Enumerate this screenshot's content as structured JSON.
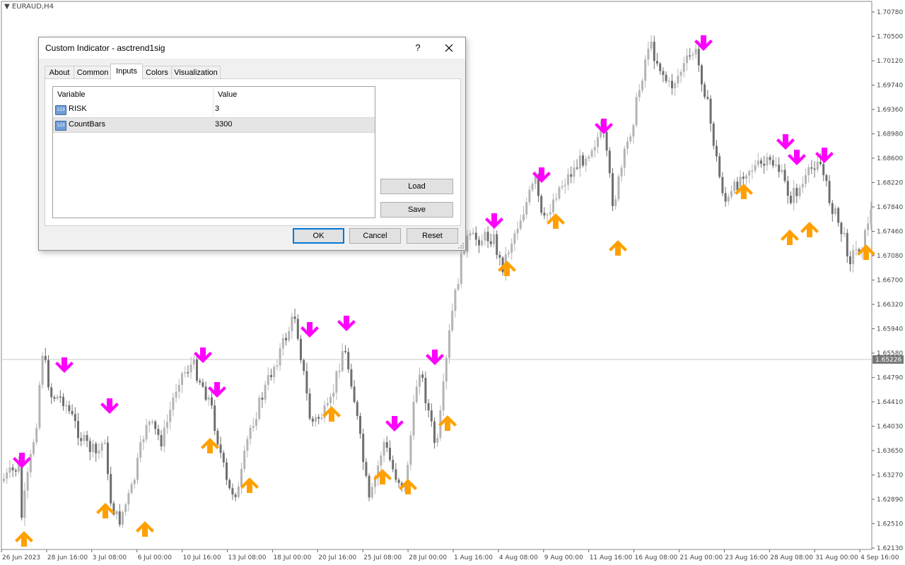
{
  "symbol": "EURAUD,H4",
  "current_price": "1.65226",
  "price_ticks": [
    "1.70780",
    "1.70500",
    "1.70120",
    "1.69740",
    "1.69360",
    "1.68980",
    "1.68600",
    "1.68220",
    "1.67840",
    "1.67460",
    "1.67080",
    "1.66700",
    "1.66320",
    "1.65940",
    "1.65580",
    "1.64790",
    "1.64410",
    "1.64030",
    "1.63650",
    "1.63270",
    "1.62890",
    "1.62510",
    "1.62130"
  ],
  "time_ticks": [
    "26 Jun 2023",
    "28 Jun 16:00",
    "3 Jul 08:00",
    "6 Jul 00:00",
    "10 Jul 16:00",
    "13 Jul 08:00",
    "18 Jul 00:00",
    "20 Jul 16:00",
    "25 Jul 08:00",
    "28 Jul 00:00",
    "1 Aug 16:00",
    "4 Aug 08:00",
    "9 Aug 00:00",
    "11 Aug 16:00",
    "16 Aug 08:00",
    "21 Aug 00:00",
    "23 Aug 16:00",
    "28 Aug 08:00",
    "31 Aug 00:00",
    "4 Sep 16:00"
  ],
  "colors": {
    "bull_candle": "#b4b4b4",
    "bear_candle": "#6e6e6e",
    "sell_arrow": "#ff00ff",
    "buy_arrow": "#ffa000"
  },
  "dialog": {
    "title": "Custom Indicator - asctrend1sig",
    "help": "?",
    "close_icon": "close-icon",
    "tabs": [
      {
        "label": "About"
      },
      {
        "label": "Common"
      },
      {
        "label": "Inputs"
      },
      {
        "label": "Colors"
      },
      {
        "label": "Visualization"
      }
    ],
    "active_tab": "Inputs",
    "columns": {
      "variable": "Variable",
      "value": "Value"
    },
    "params": [
      {
        "icon": "123",
        "name": "RISK",
        "value": "3"
      },
      {
        "icon": "123",
        "name": "CountBars",
        "value": "3300"
      }
    ],
    "load_label": "Load",
    "save_label": "Save",
    "ok_label": "OK",
    "cancel_label": "Cancel",
    "reset_label": "Reset"
  }
}
